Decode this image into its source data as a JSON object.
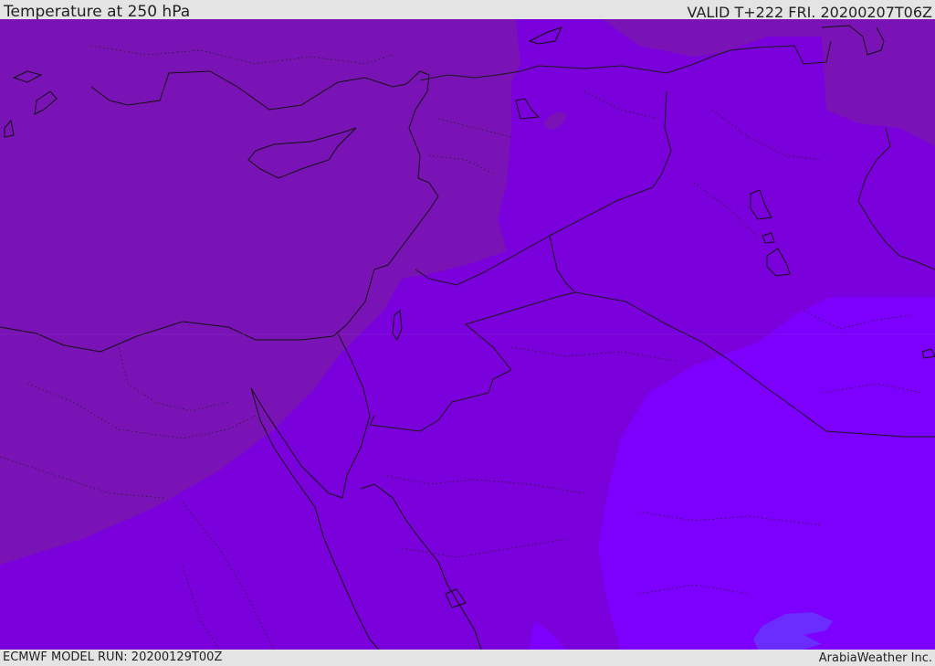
{
  "header": {
    "title": "Temperature at 250 hPa",
    "valid": "VALID T+222 FRI. 20200207T06Z"
  },
  "footer": {
    "model_run": "ECMWF MODEL RUN: 20200129T00Z",
    "credit": "ArabiaWeather Inc."
  },
  "map": {
    "field": "temperature",
    "level": "250 hPa",
    "colors": {
      "warmer_band": "#7a13b5",
      "mid_band": "#7a00dc",
      "cool_band": "#7d00ff",
      "coolest_patch": "#6a2cff",
      "coastline": "#111111",
      "border": "#1a1a1a"
    }
  }
}
